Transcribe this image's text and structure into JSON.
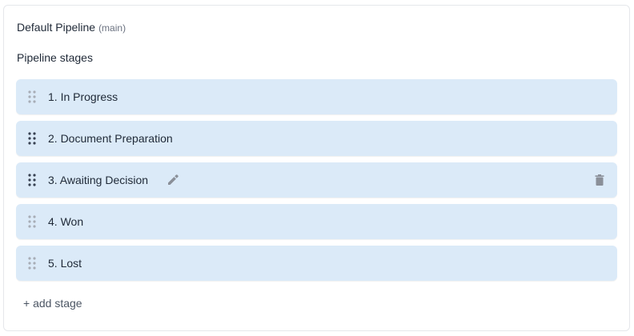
{
  "pipeline": {
    "title": "Default Pipeline",
    "tag": "(main)"
  },
  "stages_heading": "Pipeline stages",
  "stages": [
    {
      "label": "1. In Progress"
    },
    {
      "label": "2. Document Preparation"
    },
    {
      "label": "3. Awaiting Decision",
      "hovered": true
    },
    {
      "label": "4. Won"
    },
    {
      "label": "5. Lost"
    }
  ],
  "add_stage_label": "+ add stage",
  "icons": {
    "handle": "drag-handle-icon",
    "edit": "pencil-icon",
    "delete": "trash-icon"
  },
  "colors": {
    "stage_bg": "#dbeaf8",
    "handle_idle": "#9ca3af",
    "handle_active": "#374151",
    "icon": "#8a8f98"
  }
}
